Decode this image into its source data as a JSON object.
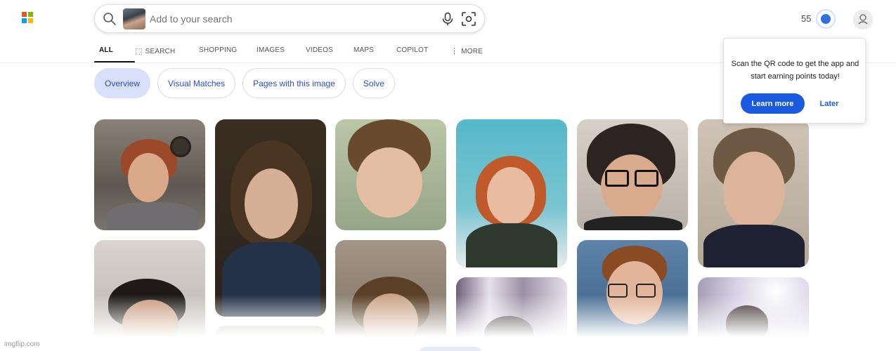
{
  "header": {
    "search_placeholder": "Add to your search",
    "points": "55"
  },
  "tabs": [
    {
      "label": "ALL",
      "active": true
    },
    {
      "label": "SEARCH",
      "icon": "copilot-search-icon"
    },
    {
      "label": "SHOPPING"
    },
    {
      "label": "IMAGES"
    },
    {
      "label": "VIDEOS"
    },
    {
      "label": "MAPS"
    },
    {
      "label": "COPILOT"
    },
    {
      "label": "MORE",
      "icon": "more-vertical-icon"
    }
  ],
  "chips": [
    {
      "label": "Overview",
      "selected": true
    },
    {
      "label": "Visual Matches"
    },
    {
      "label": "Pages with this image"
    },
    {
      "label": "Solve"
    }
  ],
  "popup": {
    "message": "Scan the QR code to get the app and start earning points today!",
    "learn_more": "Learn more",
    "later": "Later"
  },
  "watermark": "imgflip.com",
  "colors": {
    "accent": "#1a5ae0",
    "chip_text": "#2b4dc8",
    "chip_selected_bg": "#d8e0fb",
    "logo": [
      "#f25022",
      "#7fba00",
      "#00a4ef",
      "#ffb900"
    ]
  }
}
